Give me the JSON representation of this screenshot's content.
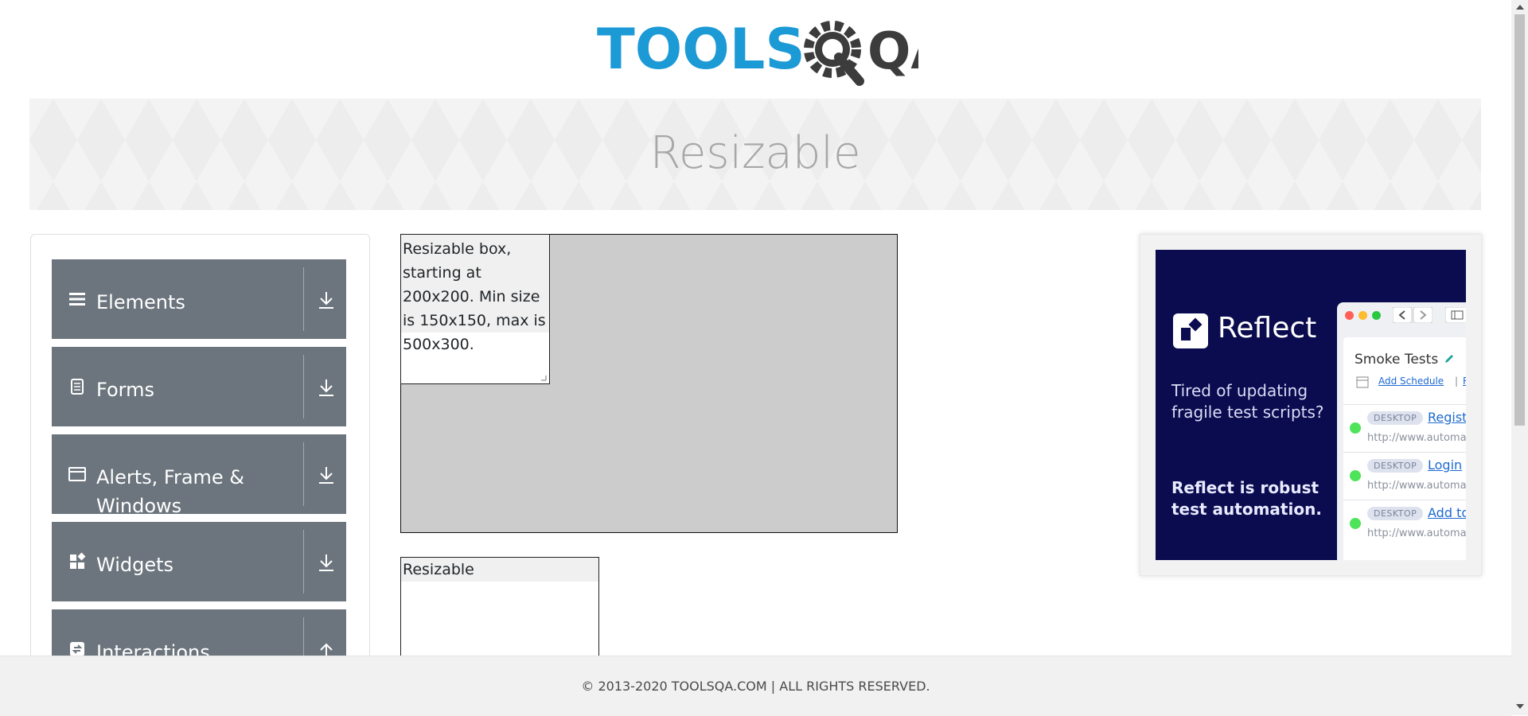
{
  "header": {
    "logo_text_left": "TOOLS",
    "logo_text_right": "QA",
    "colors": {
      "logo_blue": "#1c9ad6",
      "logo_dark": "#3c3c3c"
    }
  },
  "banner": {
    "title": "Resizable"
  },
  "sidebar": {
    "groups": [
      {
        "label": "Elements",
        "icon": "hamburger-icon",
        "toggle": "download-arrow-icon"
      },
      {
        "label": "Forms",
        "icon": "document-icon",
        "toggle": "download-arrow-icon"
      },
      {
        "label": "Alerts, Frame & Windows",
        "icon": "window-icon",
        "toggle": "download-arrow-icon"
      },
      {
        "label": "Widgets",
        "icon": "widgets-icon",
        "toggle": "download-arrow-icon"
      },
      {
        "label": "Interactions",
        "icon": "refresh-icon",
        "toggle": "upload-arrow-icon"
      }
    ],
    "colors": {
      "group_bg": "#6c757d"
    }
  },
  "resizable_restricted": {
    "text": "Resizable box, starting at 200x200. Min size is 150x150, max is 500x300."
  },
  "resizable_free": {
    "text": "Resizable"
  },
  "ad": {
    "brand": "Reflect",
    "pitch": "Tired of updating fragile test scripts?",
    "pitch_bold": "Reflect is robust test automation.",
    "suite_title": "Smoke Tests",
    "add_schedule": "Add Schedule",
    "separator": "|",
    "run_partial": "Ru",
    "rows": [
      {
        "badge": "DESKTOP",
        "name": "Registr",
        "url": "http://www.automat"
      },
      {
        "badge": "DESKTOP",
        "name": "Login",
        "url": "http://www.automat"
      },
      {
        "badge": "DESKTOP",
        "name": "Add to",
        "url": "http://www.automat"
      }
    ],
    "colors": {
      "bg": "#0b0b4f",
      "status_pass": "#4ee45a"
    }
  },
  "footer": {
    "text": "© 2013-2020 TOOLSQA.COM | ALL RIGHTS RESERVED."
  }
}
